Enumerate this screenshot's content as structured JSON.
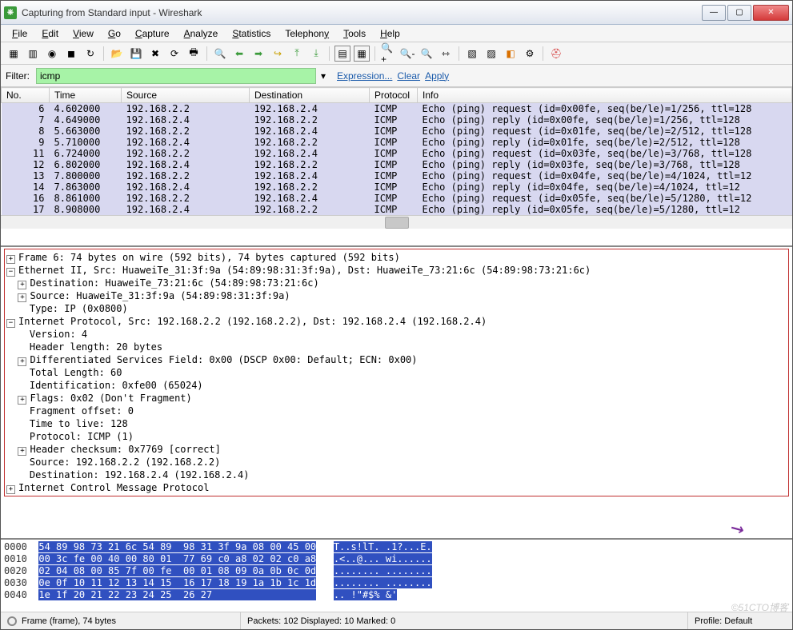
{
  "window": {
    "title": "Capturing from Standard input - Wireshark"
  },
  "menu": [
    "File",
    "Edit",
    "View",
    "Go",
    "Capture",
    "Analyze",
    "Statistics",
    "Telephony",
    "Tools",
    "Help"
  ],
  "filter": {
    "label": "Filter:",
    "value": "icmp",
    "expr": "Expression...",
    "clear": "Clear",
    "apply": "Apply"
  },
  "columns": [
    "No.",
    "Time",
    "Source",
    "Destination",
    "Protocol",
    "Info"
  ],
  "packets": [
    {
      "no": "6",
      "time": "4.602000",
      "src": "192.168.2.2",
      "dst": "192.168.2.4",
      "proto": "ICMP",
      "info": "Echo (ping) request  (id=0x00fe, seq(be/le)=1/256, ttl=128"
    },
    {
      "no": "7",
      "time": "4.649000",
      "src": "192.168.2.4",
      "dst": "192.168.2.2",
      "proto": "ICMP",
      "info": "Echo (ping) reply    (id=0x00fe, seq(be/le)=1/256, ttl=128"
    },
    {
      "no": "8",
      "time": "5.663000",
      "src": "192.168.2.2",
      "dst": "192.168.2.4",
      "proto": "ICMP",
      "info": "Echo (ping) request  (id=0x01fe, seq(be/le)=2/512, ttl=128"
    },
    {
      "no": "9",
      "time": "5.710000",
      "src": "192.168.2.4",
      "dst": "192.168.2.2",
      "proto": "ICMP",
      "info": "Echo (ping) reply    (id=0x01fe, seq(be/le)=2/512, ttl=128"
    },
    {
      "no": "11",
      "time": "6.724000",
      "src": "192.168.2.2",
      "dst": "192.168.2.4",
      "proto": "ICMP",
      "info": "Echo (ping) request  (id=0x03fe, seq(be/le)=3/768, ttl=128"
    },
    {
      "no": "12",
      "time": "6.802000",
      "src": "192.168.2.4",
      "dst": "192.168.2.2",
      "proto": "ICMP",
      "info": "Echo (ping) reply    (id=0x03fe, seq(be/le)=3/768, ttl=128"
    },
    {
      "no": "13",
      "time": "7.800000",
      "src": "192.168.2.2",
      "dst": "192.168.2.4",
      "proto": "ICMP",
      "info": "Echo (ping) request  (id=0x04fe, seq(be/le)=4/1024, ttl=12"
    },
    {
      "no": "14",
      "time": "7.863000",
      "src": "192.168.2.4",
      "dst": "192.168.2.2",
      "proto": "ICMP",
      "info": "Echo (ping) reply    (id=0x04fe, seq(be/le)=4/1024, ttl=12"
    },
    {
      "no": "16",
      "time": "8.861000",
      "src": "192.168.2.2",
      "dst": "192.168.2.4",
      "proto": "ICMP",
      "info": "Echo (ping) request  (id=0x05fe, seq(be/le)=5/1280, ttl=12"
    },
    {
      "no": "17",
      "time": "8.908000",
      "src": "192.168.2.4",
      "dst": "192.168.2.2",
      "proto": "ICMP",
      "info": "Echo (ping) reply    (id=0x05fe, seq(be/le)=5/1280, ttl=12"
    }
  ],
  "details": {
    "frame": "Frame 6: 74 bytes on wire (592 bits), 74 bytes captured (592 bits)",
    "eth": "Ethernet II, Src: HuaweiTe_31:3f:9a (54:89:98:31:3f:9a), Dst: HuaweiTe_73:21:6c (54:89:98:73:21:6c)",
    "eth_dst": "Destination: HuaweiTe_73:21:6c (54:89:98:73:21:6c)",
    "eth_src": "Source: HuaweiTe_31:3f:9a (54:89:98:31:3f:9a)",
    "eth_type": "Type: IP (0x0800)",
    "ip": "Internet Protocol, Src: 192.168.2.2 (192.168.2.2), Dst: 192.168.2.4 (192.168.2.4)",
    "ip_ver": "Version: 4",
    "ip_hlen": "Header length: 20 bytes",
    "ip_dsf": "Differentiated Services Field: 0x00 (DSCP 0x00: Default; ECN: 0x00)",
    "ip_tlen": "Total Length: 60",
    "ip_id": "Identification: 0xfe00 (65024)",
    "ip_flags": "Flags: 0x02 (Don't Fragment)",
    "ip_foff": "Fragment offset: 0",
    "ip_ttl": "Time to live: 128",
    "ip_proto": "Protocol: ICMP (1)",
    "ip_cksum": "Header checksum: 0x7769 [correct]",
    "ip_src": "Source: 192.168.2.2 (192.168.2.2)",
    "ip_dst": "Destination: 192.168.2.4 (192.168.2.4)",
    "icmp": "Internet Control Message Protocol"
  },
  "hex": [
    {
      "off": "0000",
      "b": "54 89 98 73 21 6c 54 89  98 31 3f 9a 08 00 45 00",
      "a": "T..s!lT. .1?...E."
    },
    {
      "off": "0010",
      "b": "00 3c fe 00 40 00 80 01  77 69 c0 a8 02 02 c0 a8",
      "a": ".<..@... wi......"
    },
    {
      "off": "0020",
      "b": "02 04 08 00 85 7f 00 fe  00 01 08 09 0a 0b 0c 0d",
      "a": "........ ........"
    },
    {
      "off": "0030",
      "b": "0e 0f 10 11 12 13 14 15  16 17 18 19 1a 1b 1c 1d",
      "a": "........ ........"
    },
    {
      "off": "0040",
      "b": "1e 1f 20 21 22 23 24 25  26 27                  ",
      "a": ".. !\"#$% &'"
    }
  ],
  "status": {
    "frame": "Frame (frame), 74 bytes",
    "packets": "Packets: 102 Displayed: 10 Marked: 0",
    "profile": "Profile: Default"
  },
  "watermark": "©51CTO博客"
}
